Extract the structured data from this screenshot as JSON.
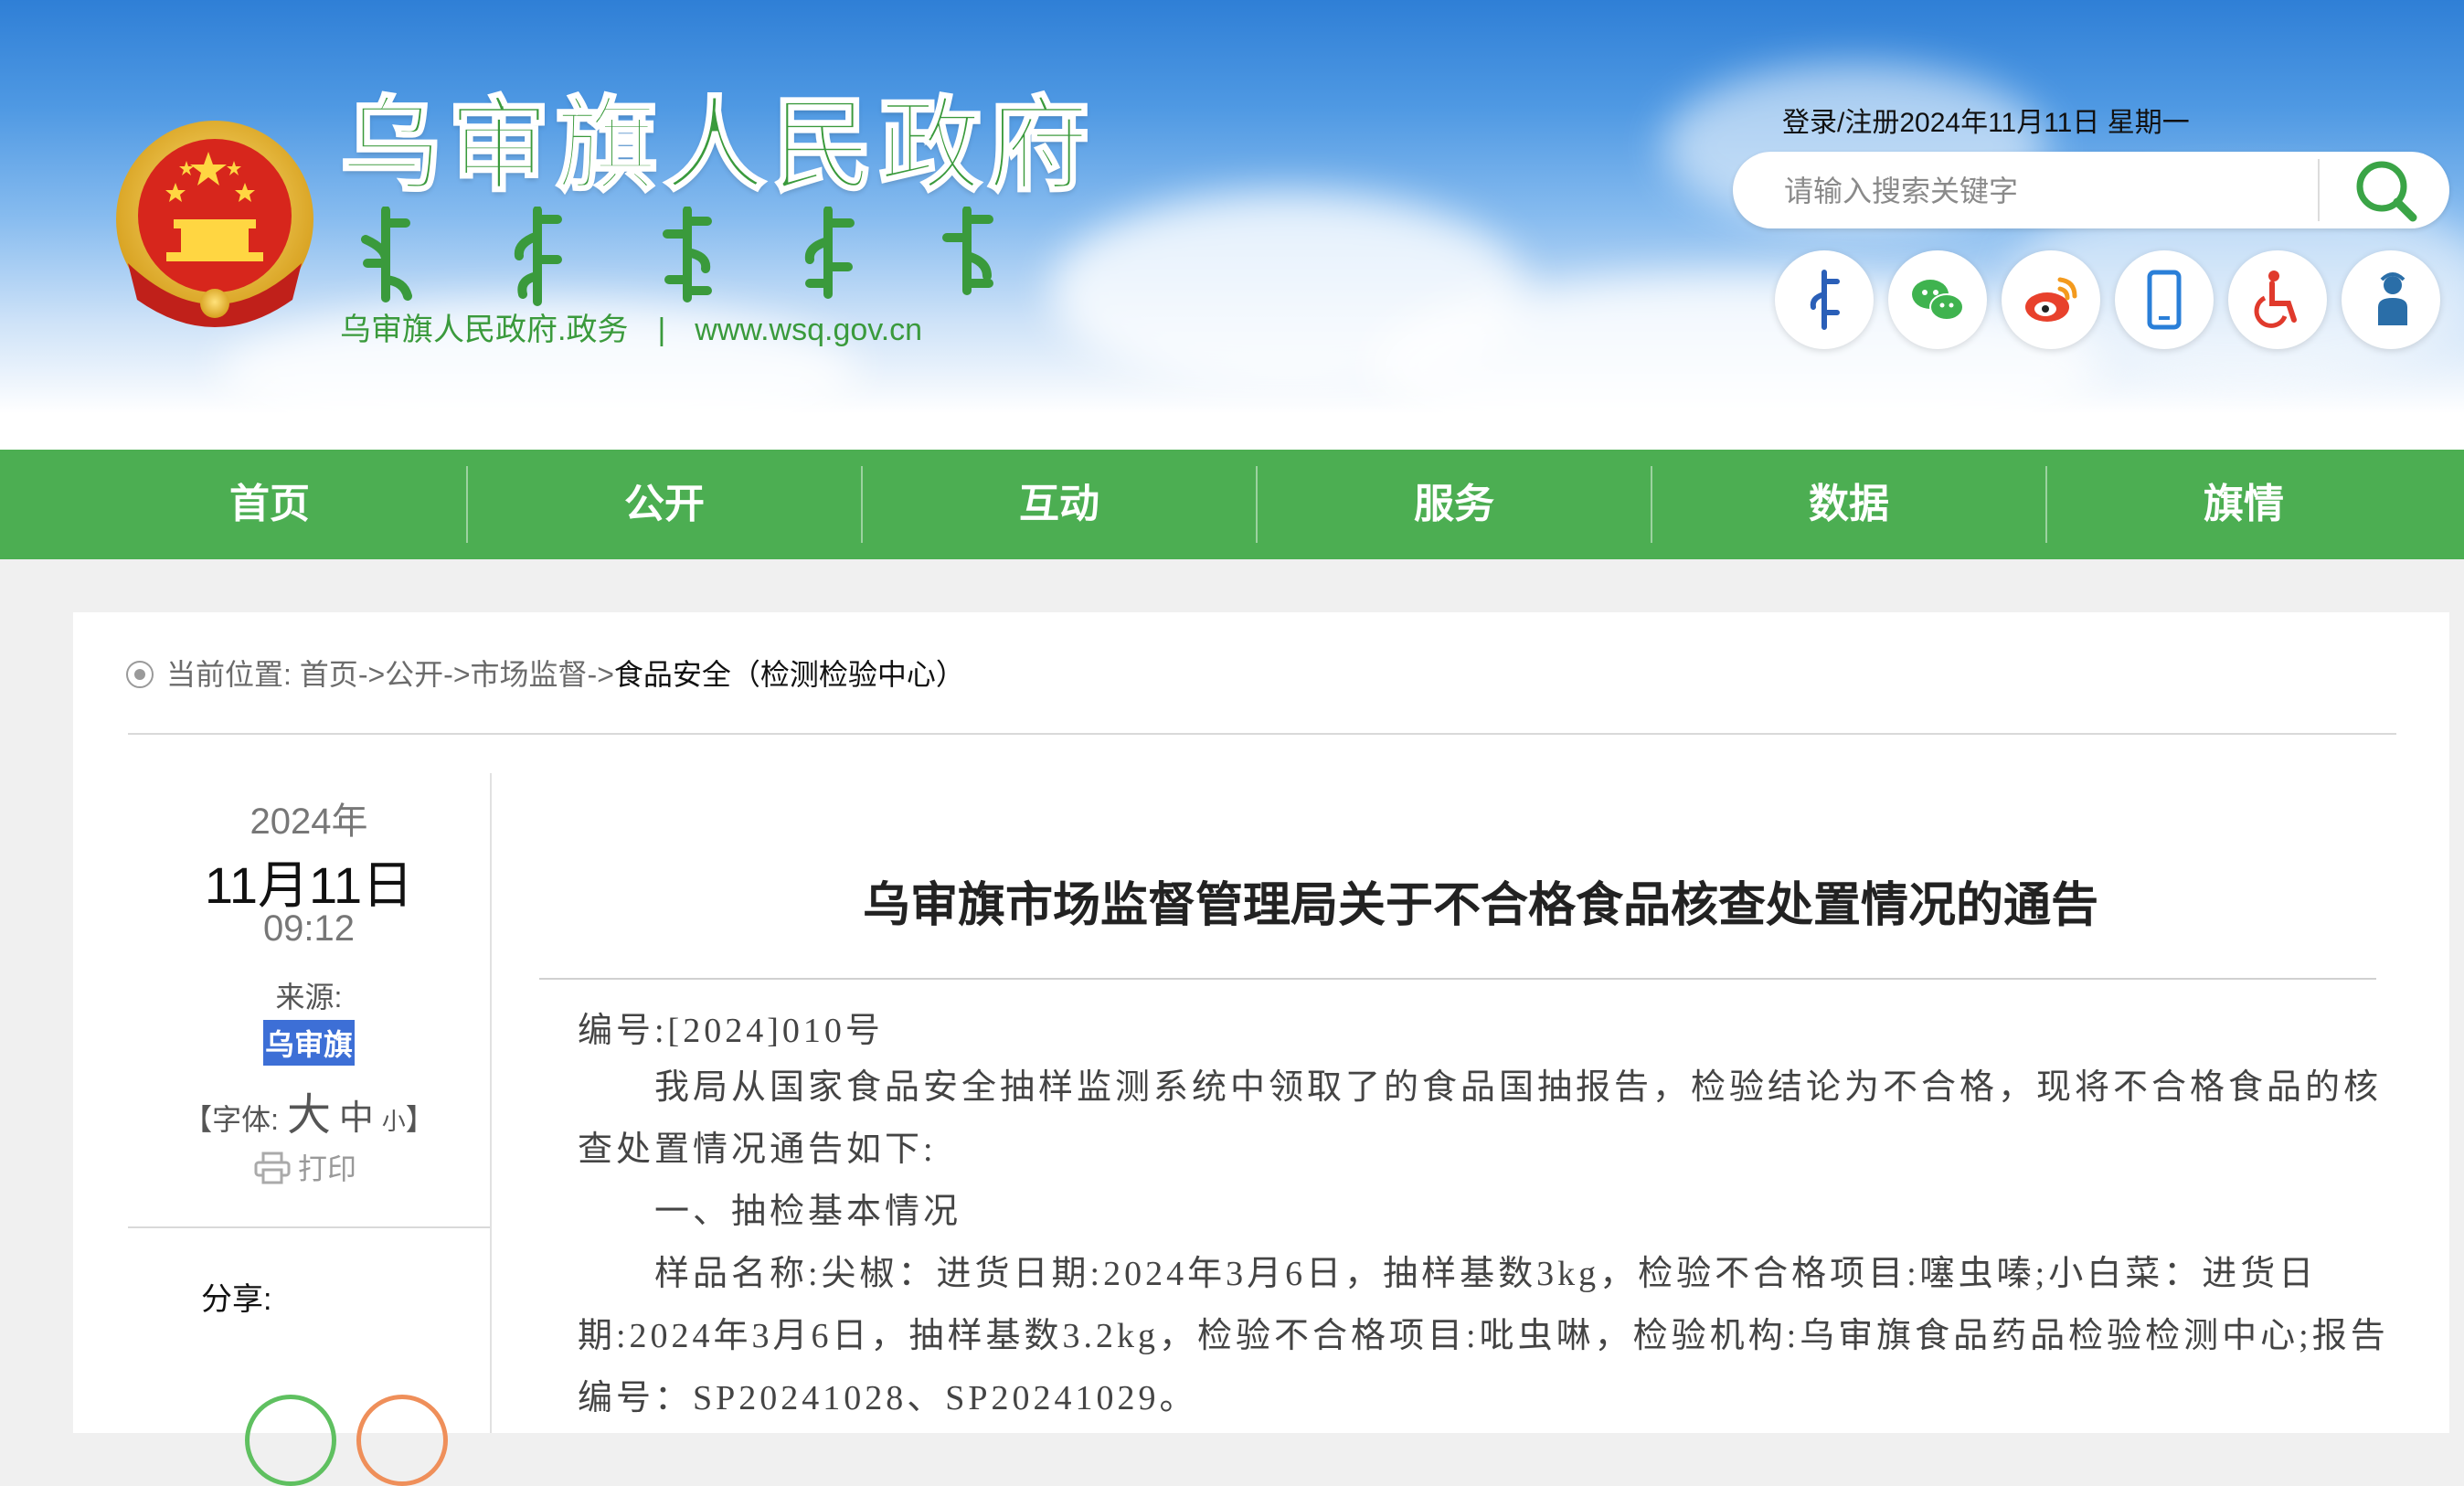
{
  "site": {
    "name": "乌审旗人民政府",
    "subtitle_left": "乌审旗人民政府.政务",
    "separator": "|",
    "url": "www.wsq.gov.cn"
  },
  "header": {
    "login_text": "登录/注册",
    "date_text": "2024年11月11日 星期一",
    "search_placeholder": "请输入搜索关键字",
    "icons": [
      "mongolian-script-icon",
      "wechat-icon",
      "weibo-icon",
      "mobile-icon",
      "accessibility-icon",
      "elderly-care-icon"
    ]
  },
  "nav": {
    "items": [
      "首页",
      "公开",
      "互动",
      "服务",
      "数据",
      "旗情"
    ]
  },
  "breadcrumb": {
    "label": "当前位置:",
    "items": [
      "首页",
      "公开",
      "市场监督"
    ],
    "arrow": "->",
    "current": "食品安全（检测检验中心）"
  },
  "sidebar": {
    "year": "2024年",
    "date": "11月11日",
    "time": "09:12",
    "source_label": "来源:",
    "source_value": "乌审旗",
    "font_label_open": "【字体:",
    "font_big": "大",
    "font_mid": "中",
    "font_small": "小",
    "font_label_close": "】",
    "print_label": "打印",
    "share_label": "分享:"
  },
  "article": {
    "title": "乌审旗市场监督管理局关于不合格食品核查处置情况的通告",
    "number": "编号:[2024]010号",
    "para1": "我局从国家食品安全抽样监测系统中领取了的食品国抽报告，检验结论为不合格，现将不合格食品的核查处置情况通告如下:",
    "section1": "一、抽检基本情况",
    "para2": "样品名称:尖椒：进货日期:2024年3月6日，抽样基数3kg，检验不合格项目:噻虫嗪;小白菜：进货日期:2024年3月6日，抽样基数3.2kg，检验不合格项目:吡虫啉，检验机构:乌审旗食品药品检验检测中心;报告编号：SP20241028、SP20241029。"
  },
  "colors": {
    "nav_green": "#4cae52",
    "title_green": "#3a9a3c",
    "source_highlight": "#3d6fd6"
  }
}
